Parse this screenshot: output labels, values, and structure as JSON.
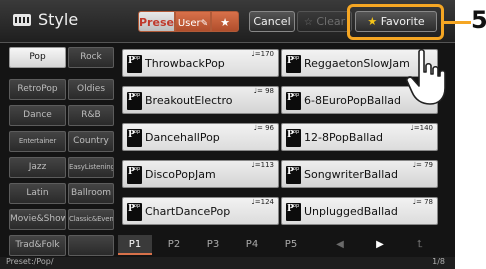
{
  "header": {
    "title": "Style",
    "preset_tab": "Preset",
    "user_tab": "User",
    "cancel": "Cancel",
    "clear": "Clear",
    "favorite": "Favorite"
  },
  "callout": {
    "number": "5"
  },
  "categories": [
    [
      "Pop",
      "Rock"
    ],
    [
      "RetroPop",
      "Oldies"
    ],
    [
      "Dance",
      "R&B"
    ],
    [
      "Entertainer",
      "Country"
    ],
    [
      "Jazz",
      "EasyListening"
    ],
    [
      "Latin",
      "Ballroom"
    ],
    [
      "Movie&Show",
      "Classic&Events"
    ],
    [
      "Trad&Folk",
      ""
    ]
  ],
  "active_category": "Pop",
  "styles": [
    {
      "name": "ThrowbackPop",
      "tempo": "♩=170"
    },
    {
      "name": "ReggaetonSlowJam",
      "tempo": ""
    },
    {
      "name": "BreakoutElectro",
      "tempo": "♩= 98"
    },
    {
      "name": "6-8EuroPopBallad",
      "tempo": "♩= 60"
    },
    {
      "name": "DancehallPop",
      "tempo": "♩= 96"
    },
    {
      "name": "12-8PopBallad",
      "tempo": "♩=140"
    },
    {
      "name": "DiscoPopJam",
      "tempo": "♩=113"
    },
    {
      "name": "SongwriterBallad",
      "tempo": "♩= 79"
    },
    {
      "name": "ChartDancePop",
      "tempo": "♩=124"
    },
    {
      "name": "UnpluggedBallad",
      "tempo": "♩= 78"
    }
  ],
  "pages": [
    "P1",
    "P2",
    "P3",
    "P4",
    "P5"
  ],
  "active_page": "P1",
  "nav": {
    "prev": "◀",
    "next": "▶",
    "up": "⮤"
  },
  "status": {
    "path": "Preset:/Pop/",
    "count": "1/8"
  },
  "colors": {
    "accent": "#d8714a",
    "callout": "#f5a623",
    "background": "#141414"
  }
}
